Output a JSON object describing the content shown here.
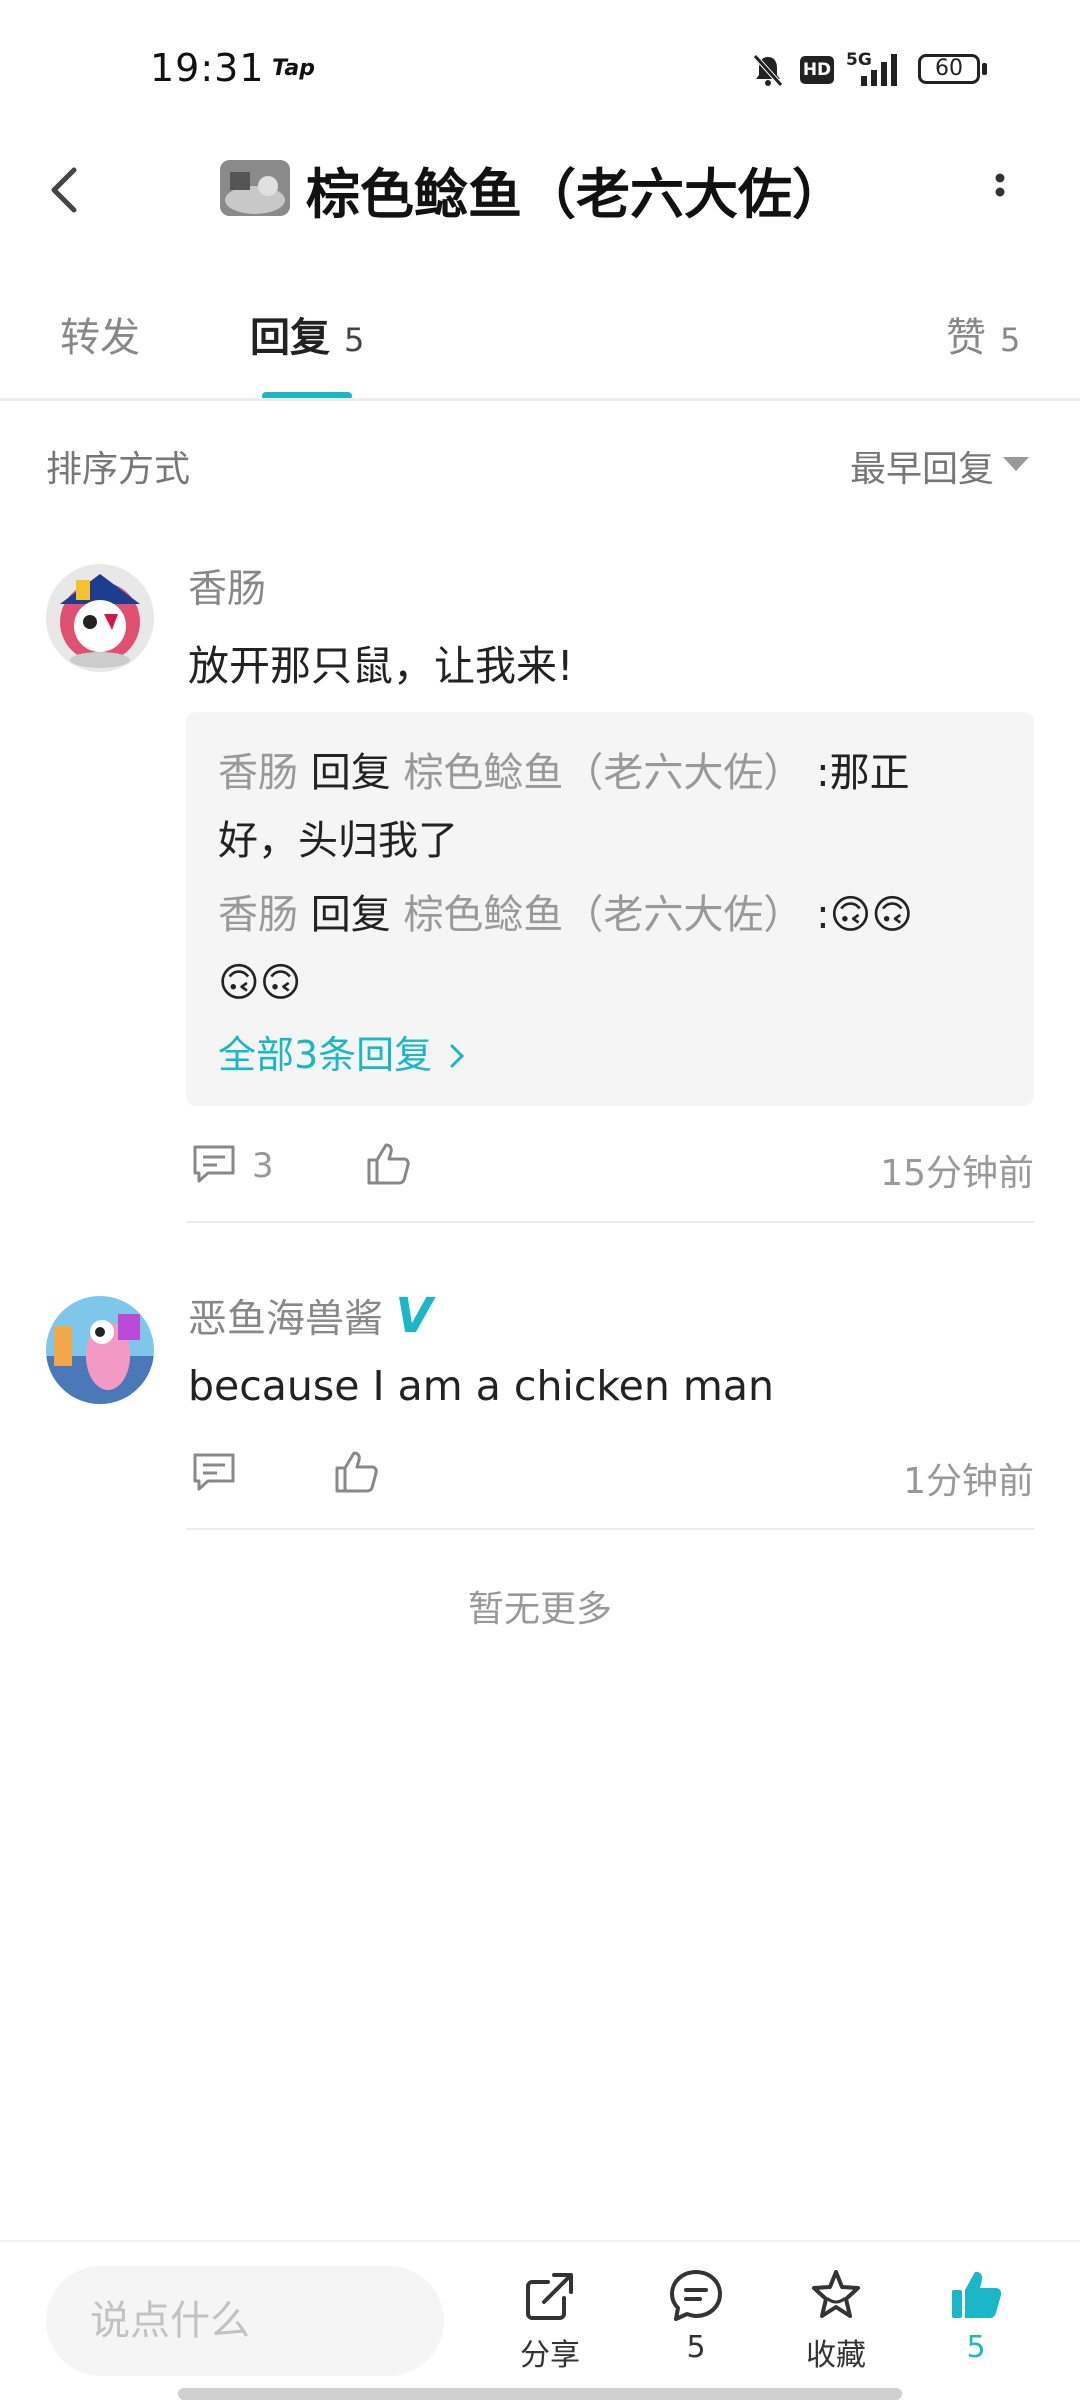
{
  "status_bar": {
    "time": "19:31",
    "app_label": "Tap",
    "network": "5G",
    "battery": "60",
    "hd_badge": "HD",
    "icons": [
      "mute-bell-icon",
      "hd-icon",
      "signal-5g-icon",
      "battery-icon"
    ]
  },
  "header": {
    "title": "棕色鲶鱼（老六大佐）",
    "back_icon": "chevron-left-icon",
    "more_icon": "more-vertical-icon"
  },
  "tabs": [
    {
      "label": "转发",
      "count": ""
    },
    {
      "label": "回复",
      "count": "5"
    },
    {
      "label": "赞",
      "count": "5"
    }
  ],
  "accent_color": "#1ab7c8",
  "sort": {
    "label": "排序方式",
    "value": "最早回复"
  },
  "comments": [
    {
      "user": "香肠",
      "text": "放开那只鼠，让我来!",
      "sub_replies": [
        {
          "user": "香肠",
          "reply_word": "回复",
          "target": "棕色鲶鱼（老六大佐）",
          "sep": ":",
          "text_1": "那正",
          "text_2": "好，头归我了"
        },
        {
          "user": "香肠",
          "reply_word": "回复",
          "target": "棕色鲶鱼（老六大佐）",
          "sep": ":",
          "text_1": "🙃🙃",
          "text_2": "🙃🙃"
        }
      ],
      "all_replies": "全部3条回复",
      "reply_count": "3",
      "time": "15分钟前"
    },
    {
      "user": "恶鱼海兽酱",
      "verified_badge": "V",
      "text": "because I am a chicken man",
      "reply_count": "",
      "time": "1分钟前"
    }
  ],
  "no_more": "暂无更多",
  "bottom_bar": {
    "input_placeholder": "说点什么",
    "share_label": "分享",
    "comment_count": "5",
    "favorite_label": "收藏",
    "like_count": "5"
  }
}
